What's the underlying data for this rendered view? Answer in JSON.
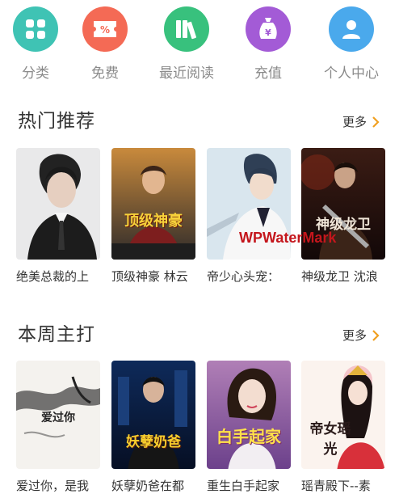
{
  "nav": [
    {
      "label": "分类",
      "icon": "grid-icon",
      "color": "#3fc3b4"
    },
    {
      "label": "免费",
      "icon": "ticket-icon",
      "color": "#f46a55"
    },
    {
      "label": "最近阅读",
      "icon": "books-icon",
      "color": "#38c17d"
    },
    {
      "label": "充值",
      "icon": "wallet-icon",
      "color": "#a35bd6"
    },
    {
      "label": "个人中心",
      "icon": "user-icon",
      "color": "#4aa9ec"
    }
  ],
  "sections": [
    {
      "title": "热门推荐",
      "more": "更多",
      "books": [
        {
          "title": "绝美总裁的上",
          "cover_text": ""
        },
        {
          "title": "顶级神豪 林云",
          "cover_text": "顶级神豪"
        },
        {
          "title": "帝少心头宠：",
          "cover_text": ""
        },
        {
          "title": "神级龙卫 沈浪",
          "cover_text": "神级龙卫"
        }
      ]
    },
    {
      "title": "本周主打",
      "more": "更多",
      "books": [
        {
          "title": "爱过你，是我",
          "cover_text": "爱过你"
        },
        {
          "title": "妖孽奶爸在都",
          "cover_text": "妖孽奶爸"
        },
        {
          "title": "重生白手起家",
          "cover_text": "白手起家"
        },
        {
          "title": "瑶青殿下--素",
          "cover_text": "帝女瑶光"
        }
      ]
    }
  ],
  "watermark": "WPWaterMark",
  "colors": {
    "chevron": "#f0a020",
    "text": "#333333",
    "label": "#8a8a8a"
  }
}
